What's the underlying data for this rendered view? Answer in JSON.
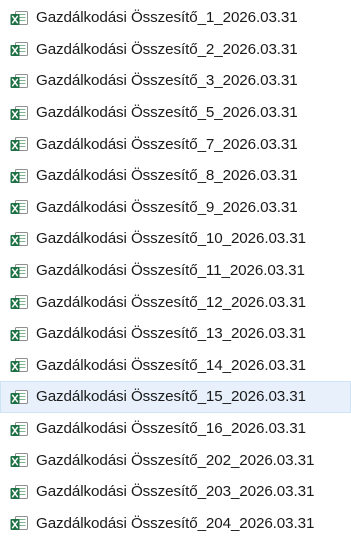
{
  "files": [
    {
      "name": "Gazdálkodási Összesítő_1_2026.03.31",
      "icon": "excel-file-icon",
      "hovered": false
    },
    {
      "name": "Gazdálkodási Összesítő_2_2026.03.31",
      "icon": "excel-file-icon",
      "hovered": false
    },
    {
      "name": "Gazdálkodási Összesítő_3_2026.03.31",
      "icon": "excel-file-icon",
      "hovered": false
    },
    {
      "name": "Gazdálkodási Összesítő_5_2026.03.31",
      "icon": "excel-file-icon",
      "hovered": false
    },
    {
      "name": "Gazdálkodási Összesítő_7_2026.03.31",
      "icon": "excel-file-icon",
      "hovered": false
    },
    {
      "name": "Gazdálkodási Összesítő_8_2026.03.31",
      "icon": "excel-file-icon",
      "hovered": false
    },
    {
      "name": "Gazdálkodási Összesítő_9_2026.03.31",
      "icon": "excel-file-icon",
      "hovered": false
    },
    {
      "name": "Gazdálkodási Összesítő_10_2026.03.31",
      "icon": "excel-file-icon",
      "hovered": false
    },
    {
      "name": "Gazdálkodási Összesítő_11_2026.03.31",
      "icon": "excel-file-icon",
      "hovered": false
    },
    {
      "name": "Gazdálkodási Összesítő_12_2026.03.31",
      "icon": "excel-file-icon",
      "hovered": false
    },
    {
      "name": "Gazdálkodási Összesítő_13_2026.03.31",
      "icon": "excel-file-icon",
      "hovered": false
    },
    {
      "name": "Gazdálkodási Összesítő_14_2026.03.31",
      "icon": "excel-file-icon",
      "hovered": false
    },
    {
      "name": "Gazdálkodási Összesítő_15_2026.03.31",
      "icon": "excel-file-icon",
      "hovered": true
    },
    {
      "name": "Gazdálkodási Összesítő_16_2026.03.31",
      "icon": "excel-file-icon",
      "hovered": false
    },
    {
      "name": "Gazdálkodási Összesítő_202_2026.03.31",
      "icon": "excel-file-icon",
      "hovered": false
    },
    {
      "name": "Gazdálkodási Összesítő_203_2026.03.31",
      "icon": "excel-file-icon",
      "hovered": false
    },
    {
      "name": "Gazdálkodási Összesítő_204_2026.03.31",
      "icon": "excel-file-icon",
      "hovered": false
    }
  ],
  "colors": {
    "excel_green": "#1d7044",
    "excel_green_light": "#21a366",
    "hover_background": "#e8f1fb",
    "text": "#1a1a1a"
  }
}
